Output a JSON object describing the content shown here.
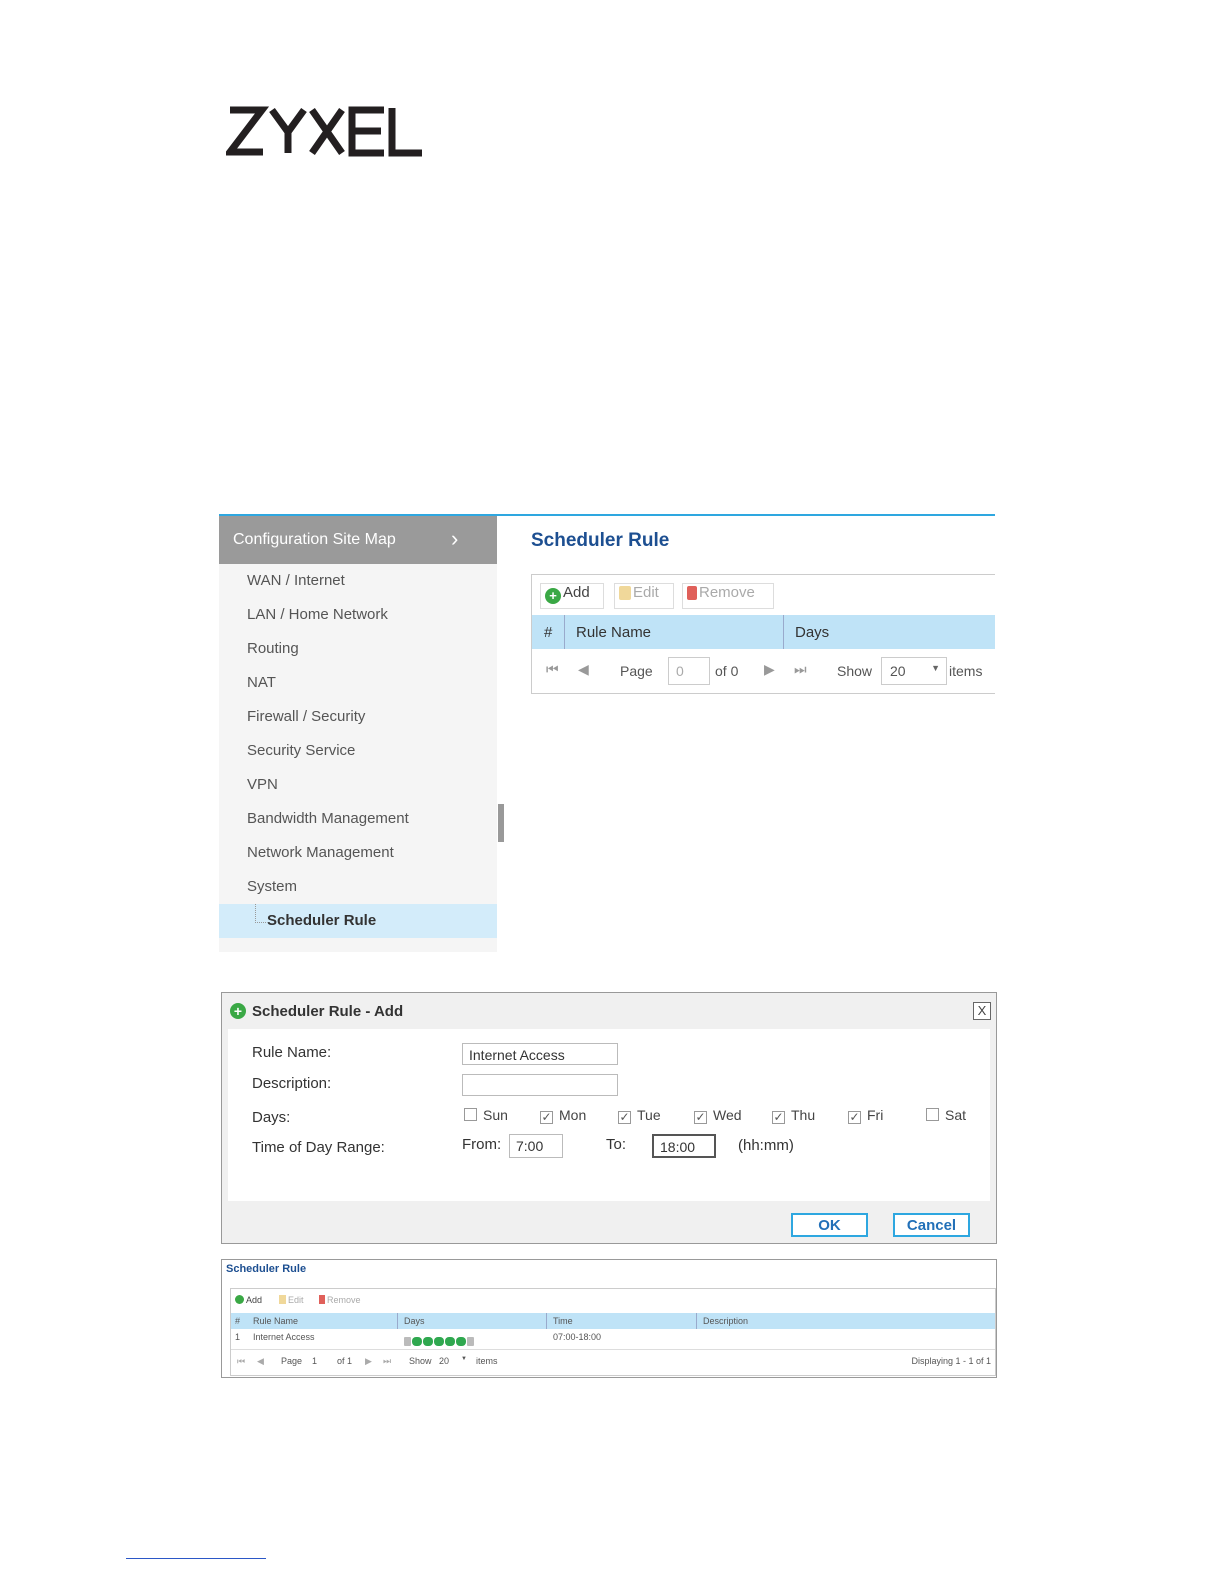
{
  "logo_text": "ZYXEL",
  "sitemap": {
    "header": "Configuration Site Map",
    "items": [
      "WAN / Internet",
      "LAN / Home Network",
      "Routing",
      "NAT",
      "Firewall / Security",
      "Security Service",
      "VPN",
      "Bandwidth Management",
      "Network Management",
      "System"
    ],
    "active": "Scheduler Rule"
  },
  "panel": {
    "title": "Scheduler Rule",
    "toolbar": {
      "add": "Add",
      "edit": "Edit",
      "remove": "Remove"
    },
    "columns": {
      "num": "#",
      "rule_name": "Rule Name",
      "days": "Days"
    },
    "pager": {
      "page_label": "Page",
      "page_value": "0",
      "of_label": "of 0",
      "show_label": "Show",
      "show_value": "20",
      "items_label": "items"
    }
  },
  "dialog": {
    "title": "Scheduler Rule - Add",
    "close": "X",
    "labels": {
      "rule_name": "Rule Name:",
      "description": "Description:",
      "days": "Days:",
      "time_range": "Time of Day Range:"
    },
    "rule_name_value": "Internet Access",
    "description_value": "",
    "days": [
      {
        "label": "Sun",
        "checked": false
      },
      {
        "label": "Mon",
        "checked": true
      },
      {
        "label": "Tue",
        "checked": true
      },
      {
        "label": "Wed",
        "checked": true
      },
      {
        "label": "Thu",
        "checked": true
      },
      {
        "label": "Fri",
        "checked": true
      },
      {
        "label": "Sat",
        "checked": false
      }
    ],
    "from_label": "From:",
    "from_value": "7:00",
    "to_label": "To:",
    "to_value": "18:00",
    "format_hint": "(hh:mm)",
    "ok": "OK",
    "cancel": "Cancel"
  },
  "result": {
    "title": "Scheduler Rule",
    "toolbar": {
      "add": "Add",
      "edit": "Edit",
      "remove": "Remove"
    },
    "columns": {
      "num": "#",
      "rule_name": "Rule Name",
      "days": "Days",
      "time": "Time",
      "description": "Description"
    },
    "row": {
      "num": "1",
      "rule_name": "Internet Access",
      "days": [
        "S",
        "M",
        "T",
        "W",
        "T",
        "F",
        "S"
      ],
      "time": "07:00-18:00",
      "description": ""
    },
    "pager": {
      "page_label": "Page",
      "page_value": "1",
      "of_label": "of 1",
      "show_label": "Show",
      "show_value": "20",
      "items_label": "items",
      "displaying": "Displaying 1 - 1 of 1"
    }
  },
  "colors": {
    "accent": "#2ea7e0",
    "title_blue": "#1d4f91",
    "header_bg": "#bfe3f7",
    "add_green": "#3aa845",
    "remove_red": "#e0605a"
  }
}
